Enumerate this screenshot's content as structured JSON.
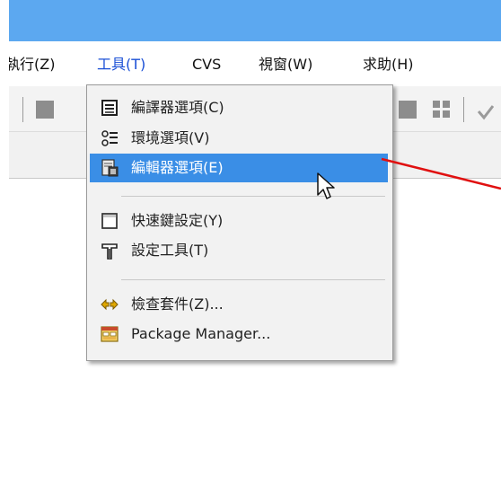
{
  "menubar": {
    "items": [
      {
        "label": "執行(Z)"
      },
      {
        "label": "工具(T)"
      },
      {
        "label": "CVS"
      },
      {
        "label": "視窗(W)"
      },
      {
        "label": "求助(H)"
      }
    ]
  },
  "dropdown": {
    "items": [
      {
        "label": "編譯器選項(C)",
        "icon": "compiler-options-icon"
      },
      {
        "label": "環境選項(V)",
        "icon": "environment-options-icon"
      },
      {
        "label": "編輯器選項(E)",
        "icon": "editor-options-icon",
        "highlighted": true
      },
      {
        "label": "快速鍵設定(Y)",
        "icon": "shortcut-config-icon"
      },
      {
        "label": "設定工具(T)",
        "icon": "hammer-icon"
      },
      {
        "label": "檢查套件(Z)...",
        "icon": "check-packages-icon"
      },
      {
        "label": "Package Manager...",
        "icon": "package-manager-icon"
      }
    ]
  },
  "colors": {
    "titlebar": "#5ca8f0",
    "highlight": "#3a8ee6",
    "menu_active_text": "#1a4fd6",
    "annotation_line": "#e01010"
  }
}
